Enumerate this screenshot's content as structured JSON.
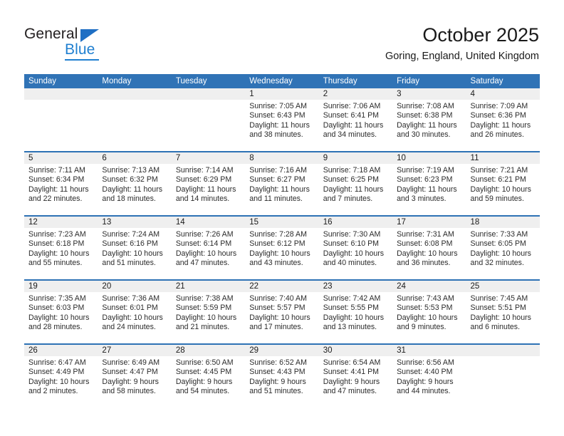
{
  "brand": {
    "name_part1": "General",
    "name_part2": "Blue",
    "triangle_icon": "triangle-icon",
    "color_dark": "#231f20",
    "color_blue": "#1f7fd0"
  },
  "header": {
    "title": "October 2025",
    "subtitle": "Goring, England, United Kingdom",
    "accent_color": "#3073b6",
    "row_band_color": "#efefef"
  },
  "weekday_headers": [
    "Sunday",
    "Monday",
    "Tuesday",
    "Wednesday",
    "Thursday",
    "Friday",
    "Saturday"
  ],
  "weeks": [
    [
      {
        "day": "",
        "sunrise": "",
        "sunset": "",
        "daylight_1": "",
        "daylight_2": ""
      },
      {
        "day": "",
        "sunrise": "",
        "sunset": "",
        "daylight_1": "",
        "daylight_2": ""
      },
      {
        "day": "",
        "sunrise": "",
        "sunset": "",
        "daylight_1": "",
        "daylight_2": ""
      },
      {
        "day": "1",
        "sunrise": "Sunrise: 7:05 AM",
        "sunset": "Sunset: 6:43 PM",
        "daylight_1": "Daylight: 11 hours",
        "daylight_2": "and 38 minutes."
      },
      {
        "day": "2",
        "sunrise": "Sunrise: 7:06 AM",
        "sunset": "Sunset: 6:41 PM",
        "daylight_1": "Daylight: 11 hours",
        "daylight_2": "and 34 minutes."
      },
      {
        "day": "3",
        "sunrise": "Sunrise: 7:08 AM",
        "sunset": "Sunset: 6:38 PM",
        "daylight_1": "Daylight: 11 hours",
        "daylight_2": "and 30 minutes."
      },
      {
        "day": "4",
        "sunrise": "Sunrise: 7:09 AM",
        "sunset": "Sunset: 6:36 PM",
        "daylight_1": "Daylight: 11 hours",
        "daylight_2": "and 26 minutes."
      }
    ],
    [
      {
        "day": "5",
        "sunrise": "Sunrise: 7:11 AM",
        "sunset": "Sunset: 6:34 PM",
        "daylight_1": "Daylight: 11 hours",
        "daylight_2": "and 22 minutes."
      },
      {
        "day": "6",
        "sunrise": "Sunrise: 7:13 AM",
        "sunset": "Sunset: 6:32 PM",
        "daylight_1": "Daylight: 11 hours",
        "daylight_2": "and 18 minutes."
      },
      {
        "day": "7",
        "sunrise": "Sunrise: 7:14 AM",
        "sunset": "Sunset: 6:29 PM",
        "daylight_1": "Daylight: 11 hours",
        "daylight_2": "and 14 minutes."
      },
      {
        "day": "8",
        "sunrise": "Sunrise: 7:16 AM",
        "sunset": "Sunset: 6:27 PM",
        "daylight_1": "Daylight: 11 hours",
        "daylight_2": "and 11 minutes."
      },
      {
        "day": "9",
        "sunrise": "Sunrise: 7:18 AM",
        "sunset": "Sunset: 6:25 PM",
        "daylight_1": "Daylight: 11 hours",
        "daylight_2": "and 7 minutes."
      },
      {
        "day": "10",
        "sunrise": "Sunrise: 7:19 AM",
        "sunset": "Sunset: 6:23 PM",
        "daylight_1": "Daylight: 11 hours",
        "daylight_2": "and 3 minutes."
      },
      {
        "day": "11",
        "sunrise": "Sunrise: 7:21 AM",
        "sunset": "Sunset: 6:21 PM",
        "daylight_1": "Daylight: 10 hours",
        "daylight_2": "and 59 minutes."
      }
    ],
    [
      {
        "day": "12",
        "sunrise": "Sunrise: 7:23 AM",
        "sunset": "Sunset: 6:18 PM",
        "daylight_1": "Daylight: 10 hours",
        "daylight_2": "and 55 minutes."
      },
      {
        "day": "13",
        "sunrise": "Sunrise: 7:24 AM",
        "sunset": "Sunset: 6:16 PM",
        "daylight_1": "Daylight: 10 hours",
        "daylight_2": "and 51 minutes."
      },
      {
        "day": "14",
        "sunrise": "Sunrise: 7:26 AM",
        "sunset": "Sunset: 6:14 PM",
        "daylight_1": "Daylight: 10 hours",
        "daylight_2": "and 47 minutes."
      },
      {
        "day": "15",
        "sunrise": "Sunrise: 7:28 AM",
        "sunset": "Sunset: 6:12 PM",
        "daylight_1": "Daylight: 10 hours",
        "daylight_2": "and 43 minutes."
      },
      {
        "day": "16",
        "sunrise": "Sunrise: 7:30 AM",
        "sunset": "Sunset: 6:10 PM",
        "daylight_1": "Daylight: 10 hours",
        "daylight_2": "and 40 minutes."
      },
      {
        "day": "17",
        "sunrise": "Sunrise: 7:31 AM",
        "sunset": "Sunset: 6:08 PM",
        "daylight_1": "Daylight: 10 hours",
        "daylight_2": "and 36 minutes."
      },
      {
        "day": "18",
        "sunrise": "Sunrise: 7:33 AM",
        "sunset": "Sunset: 6:05 PM",
        "daylight_1": "Daylight: 10 hours",
        "daylight_2": "and 32 minutes."
      }
    ],
    [
      {
        "day": "19",
        "sunrise": "Sunrise: 7:35 AM",
        "sunset": "Sunset: 6:03 PM",
        "daylight_1": "Daylight: 10 hours",
        "daylight_2": "and 28 minutes."
      },
      {
        "day": "20",
        "sunrise": "Sunrise: 7:36 AM",
        "sunset": "Sunset: 6:01 PM",
        "daylight_1": "Daylight: 10 hours",
        "daylight_2": "and 24 minutes."
      },
      {
        "day": "21",
        "sunrise": "Sunrise: 7:38 AM",
        "sunset": "Sunset: 5:59 PM",
        "daylight_1": "Daylight: 10 hours",
        "daylight_2": "and 21 minutes."
      },
      {
        "day": "22",
        "sunrise": "Sunrise: 7:40 AM",
        "sunset": "Sunset: 5:57 PM",
        "daylight_1": "Daylight: 10 hours",
        "daylight_2": "and 17 minutes."
      },
      {
        "day": "23",
        "sunrise": "Sunrise: 7:42 AM",
        "sunset": "Sunset: 5:55 PM",
        "daylight_1": "Daylight: 10 hours",
        "daylight_2": "and 13 minutes."
      },
      {
        "day": "24",
        "sunrise": "Sunrise: 7:43 AM",
        "sunset": "Sunset: 5:53 PM",
        "daylight_1": "Daylight: 10 hours",
        "daylight_2": "and 9 minutes."
      },
      {
        "day": "25",
        "sunrise": "Sunrise: 7:45 AM",
        "sunset": "Sunset: 5:51 PM",
        "daylight_1": "Daylight: 10 hours",
        "daylight_2": "and 6 minutes."
      }
    ],
    [
      {
        "day": "26",
        "sunrise": "Sunrise: 6:47 AM",
        "sunset": "Sunset: 4:49 PM",
        "daylight_1": "Daylight: 10 hours",
        "daylight_2": "and 2 minutes."
      },
      {
        "day": "27",
        "sunrise": "Sunrise: 6:49 AM",
        "sunset": "Sunset: 4:47 PM",
        "daylight_1": "Daylight: 9 hours",
        "daylight_2": "and 58 minutes."
      },
      {
        "day": "28",
        "sunrise": "Sunrise: 6:50 AM",
        "sunset": "Sunset: 4:45 PM",
        "daylight_1": "Daylight: 9 hours",
        "daylight_2": "and 54 minutes."
      },
      {
        "day": "29",
        "sunrise": "Sunrise: 6:52 AM",
        "sunset": "Sunset: 4:43 PM",
        "daylight_1": "Daylight: 9 hours",
        "daylight_2": "and 51 minutes."
      },
      {
        "day": "30",
        "sunrise": "Sunrise: 6:54 AM",
        "sunset": "Sunset: 4:41 PM",
        "daylight_1": "Daylight: 9 hours",
        "daylight_2": "and 47 minutes."
      },
      {
        "day": "31",
        "sunrise": "Sunrise: 6:56 AM",
        "sunset": "Sunset: 4:40 PM",
        "daylight_1": "Daylight: 9 hours",
        "daylight_2": "and 44 minutes."
      },
      {
        "day": "",
        "sunrise": "",
        "sunset": "",
        "daylight_1": "",
        "daylight_2": ""
      }
    ]
  ]
}
